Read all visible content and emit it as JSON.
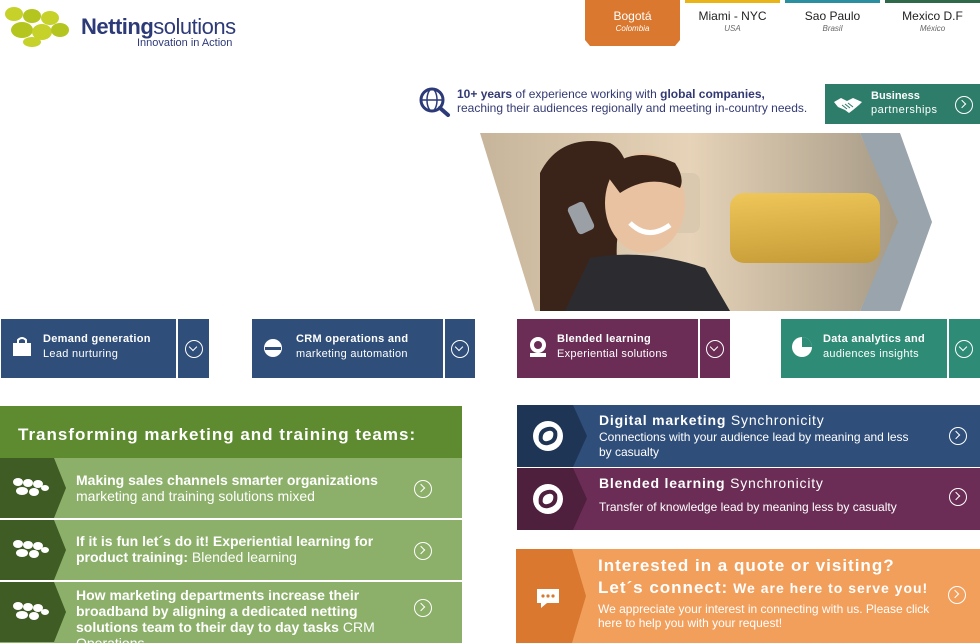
{
  "logo": {
    "name_bold": "Netting",
    "name_light": "solutions",
    "tagline": "Innovation in Action"
  },
  "cities": [
    {
      "name": "Bogotá",
      "country": "Colombia",
      "active": true,
      "color": "#d9782e"
    },
    {
      "name": "Miami - NYC",
      "country": "USA",
      "active": false,
      "color": "#e8b418"
    },
    {
      "name": "Sao Paulo",
      "country": "Brasil",
      "active": false,
      "color": "#2a8fa0"
    },
    {
      "name": "Mexico D.F",
      "country": "México",
      "active": false,
      "color": "#2e6a4a"
    }
  ],
  "experience": {
    "bold1": "10+ years",
    "text1": " of experience working with ",
    "bold2": "global companies,",
    "line2": "reaching their audiences regionally and meeting in-country needs."
  },
  "business": {
    "line1": "Business",
    "line2": "partnerships"
  },
  "services": [
    {
      "title": "Demand generation",
      "subtitle": "Lead nurturing",
      "color": "#2f4e7a",
      "icon": "shopping-bag-icon"
    },
    {
      "title": "CRM operations and",
      "subtitle": "marketing automation",
      "color": "#2f4e7a",
      "icon": "headset-icon"
    },
    {
      "title": "Blended learning",
      "subtitle": "Experiential solutions",
      "color": "#6b2d55",
      "icon": "award-icon"
    },
    {
      "title": "Data analytics and",
      "subtitle": "audiences insights",
      "color": "#2e8b76",
      "icon": "pie-chart-icon"
    }
  ],
  "left_section": {
    "heading": "Transforming marketing and training teams:",
    "items": [
      {
        "bold": "Making sales channels smarter organizations",
        "light": "marketing and training solutions mixed"
      },
      {
        "bold": "If it is fun let´s do it! Experiential learning for product training:",
        "light": " Blended learning"
      },
      {
        "bold": "How marketing departments increase their broadband by aligning a dedicated netting solutions team to their day to day tasks",
        "light": " CRM Operations"
      }
    ]
  },
  "right_section": {
    "items": [
      {
        "bold": "Digital marketing",
        "light": " Synchronicity",
        "sub": "Connections with your audience lead by meaning and less by casualty",
        "color": "#2f4e7a"
      },
      {
        "bold": "Blended learning",
        "light": " Synchronicity",
        "sub": "Transfer of knowledge lead by meaning less by casualty",
        "color": "#6b2d55"
      }
    ],
    "quote": {
      "line1": "Interested in a quote or visiting?",
      "line2": "Let´s connect:",
      "line2_small": " We are here to serve you!",
      "line3": "We appreciate your interest in  connecting with us. Please click here to help you with your request!"
    }
  },
  "colors": {
    "brand_navy": "#2d3a78",
    "brand_green": "#b5c51f",
    "orange": "#d9782e"
  }
}
